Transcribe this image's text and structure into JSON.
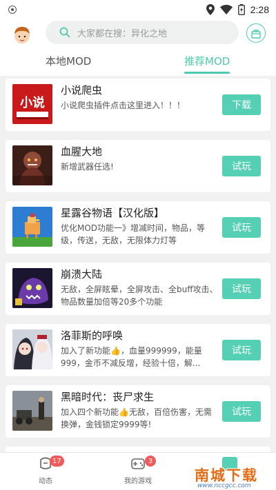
{
  "status_bar": {
    "time": "2:28"
  },
  "header": {
    "search_placeholder": "大家都在搜：异化之地"
  },
  "tabs": {
    "local": "本地MOD",
    "recommend": "推荐MOD"
  },
  "colors": {
    "accent": "#4cc9ad",
    "button": "#55d0b4",
    "badge": "#ef5b5b"
  },
  "mods": [
    {
      "title": "小说爬虫",
      "desc": "小说爬虫插件点击这里进入！！！",
      "button": "下载",
      "icon": "novel-book-icon"
    },
    {
      "title": "血腥大地",
      "desc": "新增武器任选!",
      "button": "试玩",
      "icon": "zombie-game-icon"
    },
    {
      "title": "星露谷物语【汉化版】",
      "desc": "优化MOD功能一》增减时间，物品，等级，传送，无敌，无限体力灯等",
      "button": "试玩",
      "icon": "chicken-game-icon"
    },
    {
      "title": "崩溃大陆",
      "desc": "无敌，全屏眩晕，全屏攻击、全buff攻击、物品数量加倍等20多个功能",
      "button": "试玩",
      "icon": "monster-game-icon"
    },
    {
      "title": "洛菲斯的呼唤",
      "desc": "加入了新功能👍，血量999999，能量999，金币不减反增，经验十倍，解...",
      "button": "试玩",
      "icon": "anime-girls-icon"
    },
    {
      "title": "黑暗时代：丧尸求生",
      "desc": "加入四个新功能👍无敌，百倍伤害，无需换弹，金钱锁定9999等!",
      "button": "试玩",
      "icon": "survival-game-icon"
    }
  ],
  "bottom_nav": {
    "feed": {
      "label": "动态",
      "badge": "17"
    },
    "games": {
      "label": "我的游戏",
      "badge": "3"
    }
  },
  "watermark": {
    "text": "南城下载",
    "url": "www.nccgcc.com"
  }
}
